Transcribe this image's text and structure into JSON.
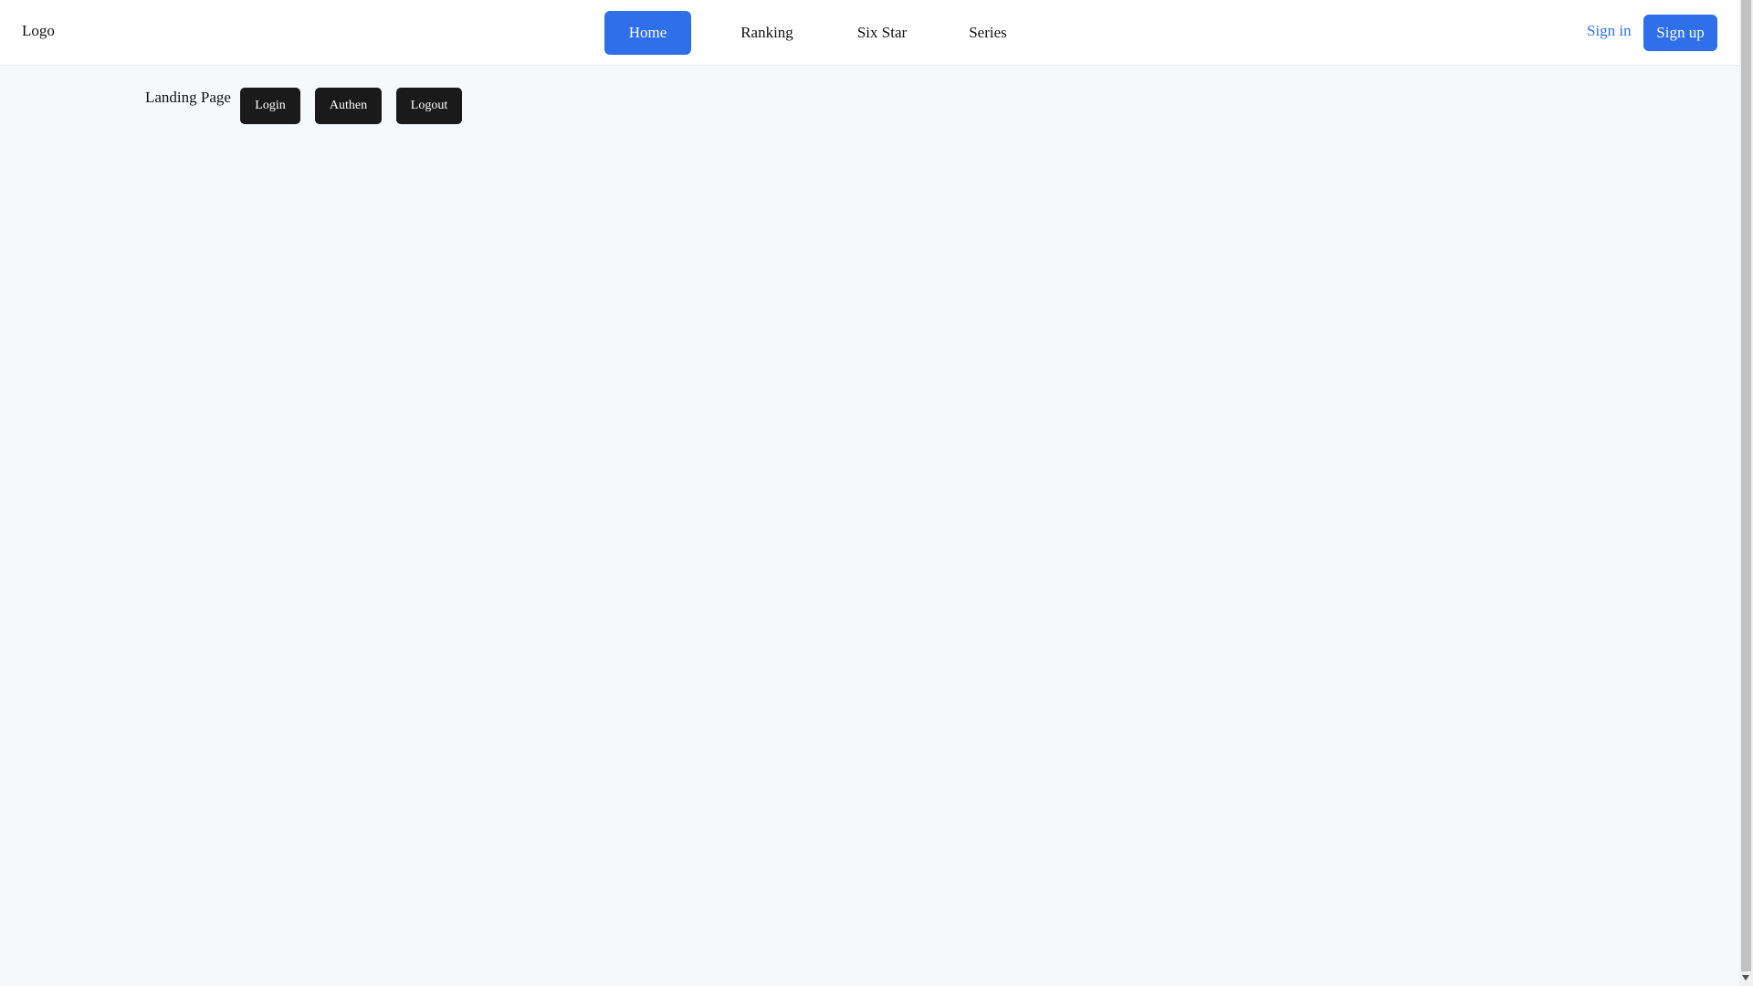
{
  "header": {
    "logo": "Logo",
    "nav": [
      {
        "label": "Home",
        "active": true
      },
      {
        "label": "Ranking",
        "active": false
      },
      {
        "label": "Six Star",
        "active": false
      },
      {
        "label": "Series",
        "active": false
      }
    ],
    "sign_in": "Sign in",
    "sign_up": "Sign up"
  },
  "main": {
    "title": "Landing Page",
    "buttons": {
      "login": "Login",
      "authen": "Authen",
      "logout": "Logout"
    }
  },
  "colors": {
    "accent": "#2f6fea",
    "background": "#f6f8fa",
    "dark_button": "#1a1a1a"
  },
  "icons": {
    "scroll_down": "chevron-down-icon"
  }
}
